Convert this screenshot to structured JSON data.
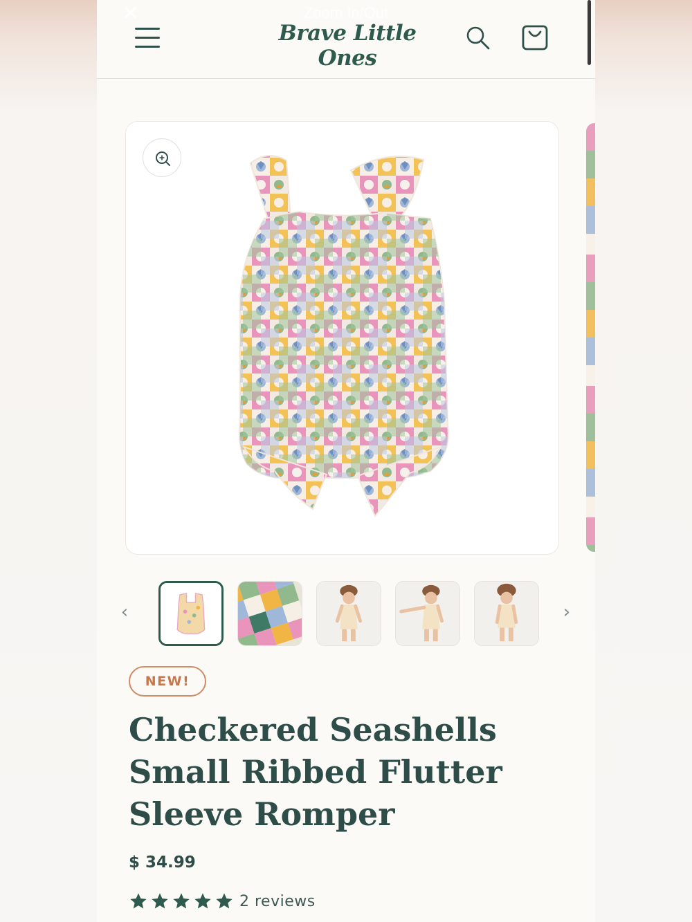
{
  "overlay": {
    "zoom_label": "Zoom In/Out",
    "close_glyph": "✕"
  },
  "header": {
    "menu_icon": "hamburger-menu-icon",
    "logo": "Brave Little Ones",
    "search_icon": "search-icon",
    "cart_icon": "shopping-bag-icon"
  },
  "gallery": {
    "zoom_icon": "zoom-in-icon",
    "main_image_alt": "Checkered Seashells romper product photo",
    "prev_glyph": "‹",
    "next_glyph": "›",
    "thumbnails": [
      {
        "kind": "romper-flat",
        "selected": true
      },
      {
        "kind": "fabric-closeup",
        "selected": false
      },
      {
        "kind": "model-front",
        "selected": false
      },
      {
        "kind": "model-pointing",
        "selected": false
      },
      {
        "kind": "model-side",
        "selected": false
      }
    ]
  },
  "product": {
    "badge": "NEW!",
    "title": "Checkered Seashells Small Ribbed Flutter Sleeve Romper",
    "price": "$ 34.99",
    "rating": 5,
    "reviews_label": "2 reviews"
  },
  "colors": {
    "brand_green": "#2f5a4e",
    "badge_orange": "#c8764b",
    "pattern": [
      "#e58fb3",
      "#8fb58a",
      "#f0b545",
      "#9eb5d6",
      "#f6efe6",
      "#3e7a66"
    ]
  }
}
